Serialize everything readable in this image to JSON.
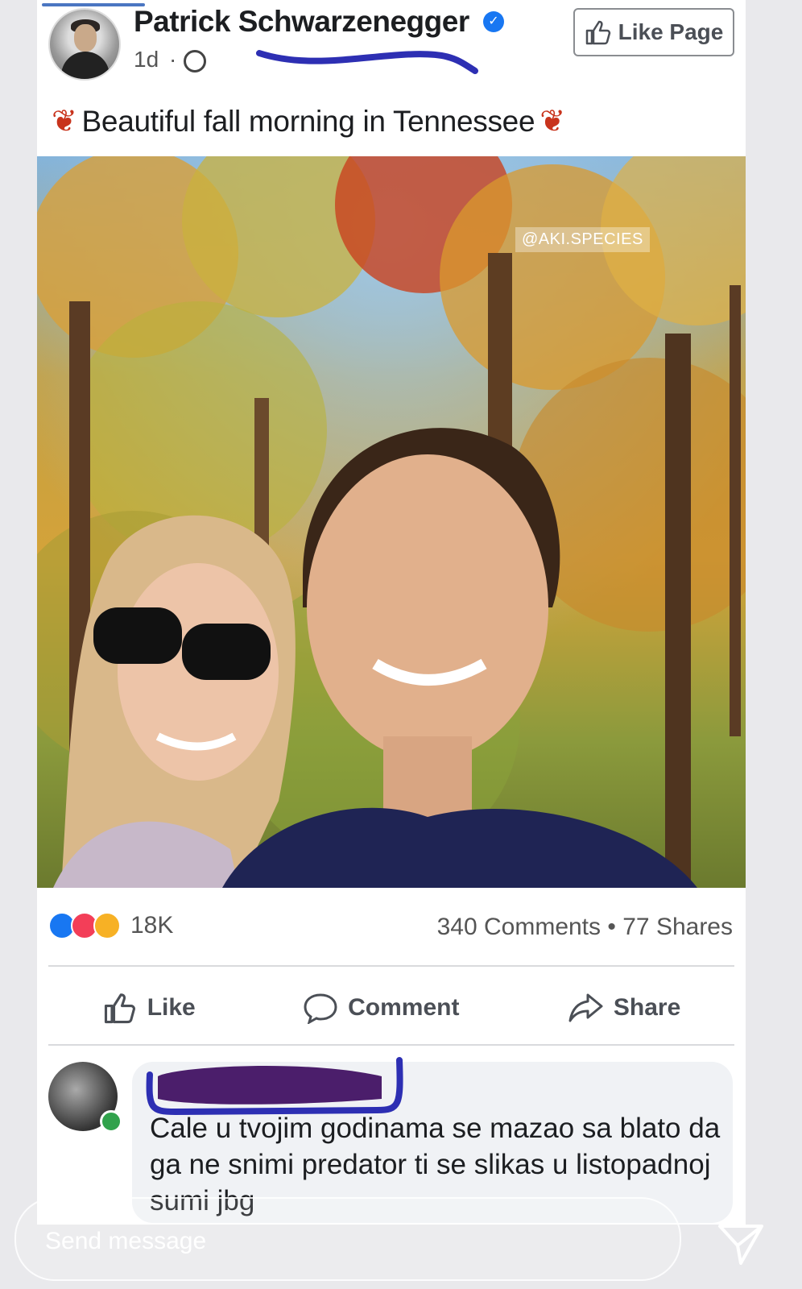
{
  "post": {
    "author": "Patrick Schwarzenegger",
    "time": "1d",
    "like_page_label": "Like Page",
    "caption": "Beautiful fall morning in Tennessee",
    "leaf_icon": "maple-leaf-icon",
    "photo_watermark": "@AKI.SPECIES"
  },
  "stats": {
    "reactions": "18K",
    "comments": "340 Comments",
    "shares": "77 Shares",
    "separator": "•"
  },
  "actions": {
    "like": "Like",
    "comment": "Comment",
    "share": "Share"
  },
  "comment": {
    "text": "Cale u tvojim godinama se mazao sa blato da ga ne snimi predator ti se slikas u listopadnoj sumi jbg"
  },
  "story": {
    "send_placeholder": "Send message"
  },
  "colors": {
    "fb_blue": "#1877f2",
    "scribble": "#2d2fb3",
    "redaction": "#4b1e6b"
  }
}
